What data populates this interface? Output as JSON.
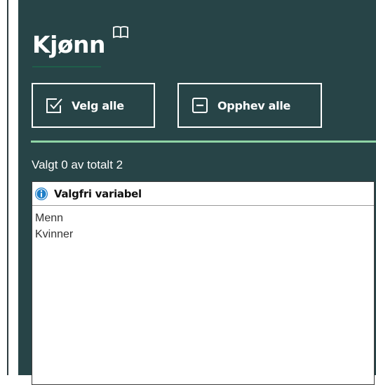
{
  "panel": {
    "title": "Kjønn",
    "icons": {
      "title": "book-open-icon",
      "select_all": "checkbox-icon",
      "deselect_all": "minus-box-icon",
      "info": "info-icon"
    },
    "buttons": {
      "select_all_label": "Velg alle",
      "deselect_all_label": "Opphev alle"
    },
    "selection_count": "Valgt 0 av totalt 2",
    "list": {
      "header": "Valgfri variabel",
      "items": [
        {
          "label": "Menn"
        },
        {
          "label": "Kvinner"
        }
      ]
    }
  },
  "colors": {
    "panel_bg": "#274447",
    "accent_line": "#8fd5a6",
    "info_icon": "#1f7fc8"
  }
}
